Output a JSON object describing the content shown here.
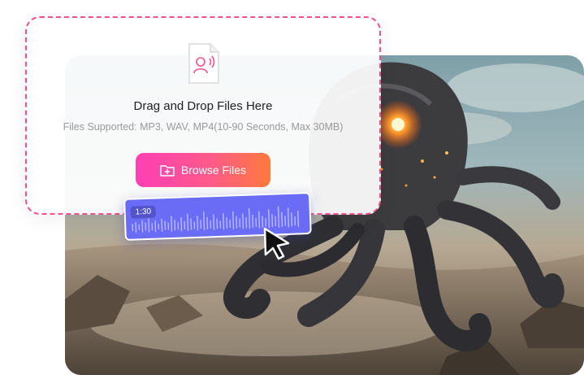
{
  "upload": {
    "title": "Drag and Drop Files Here",
    "supported": "Files Supported: MP3, WAV, MP4(10-90 Seconds, Max 30MB)",
    "browse_label": "Browse Files",
    "file_icon": "audio-file-icon",
    "browse_icon": "folder-plus-icon"
  },
  "waveform": {
    "time": "1:30"
  },
  "colors": {
    "dashed_border": "#f0508c",
    "button_gradient_start": "#ff3fb5",
    "button_gradient_end": "#ff7a3c",
    "waveform_bg": "#6a6cf6"
  }
}
